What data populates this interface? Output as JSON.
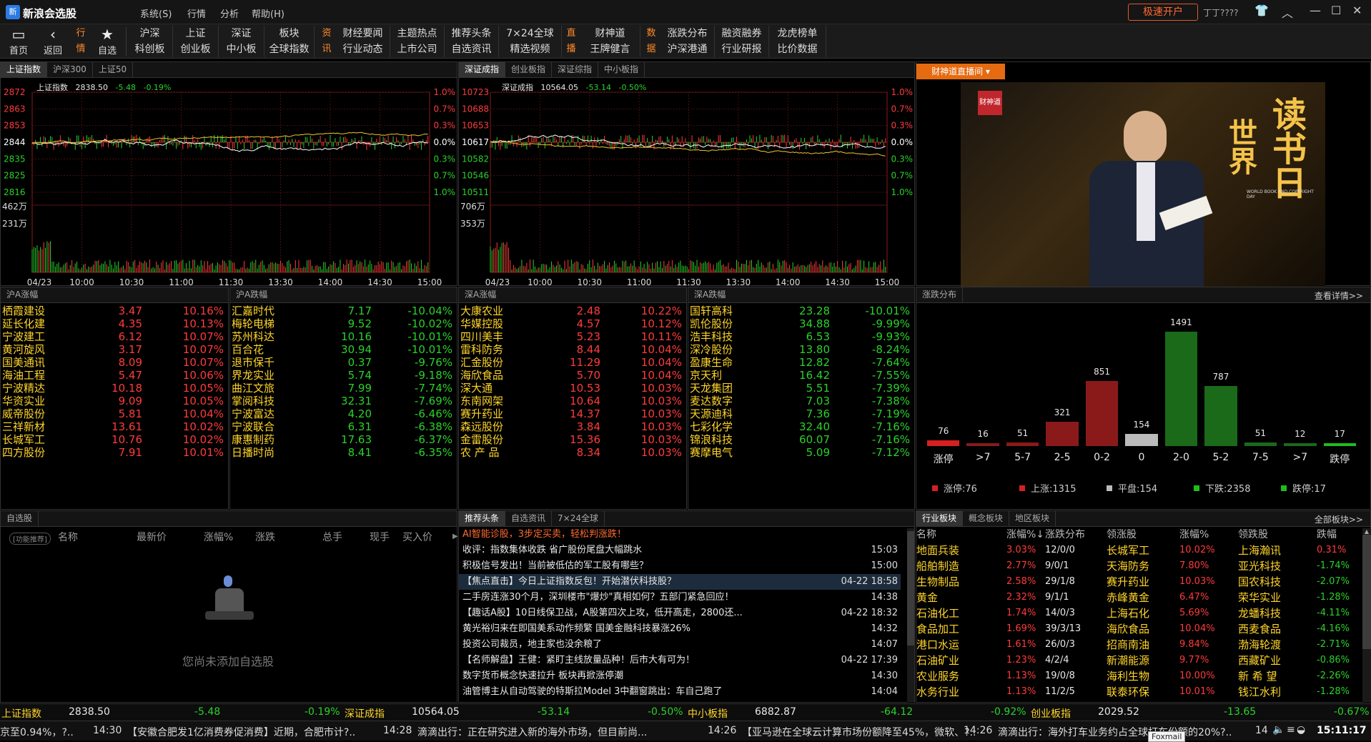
{
  "titlebar": {
    "logo": "新",
    "app_name": "新浪会选股",
    "menus": [
      "系统(S)",
      "行情",
      "分析",
      "帮助(H)"
    ],
    "kaihu": "极速开户",
    "user": "丁丁????",
    "window_buttons": [
      "shirt-icon",
      "chevron-up-icon",
      "minimize-icon",
      "maximize-icon",
      "close-icon"
    ]
  },
  "toolbar": {
    "home": "首页",
    "back": "返回",
    "fav": "自选",
    "tag_hq": "行情",
    "tag_zx": "资讯",
    "tag_zb": "直播",
    "tag_sj": "数据",
    "hq_row1": [
      "沪深",
      "上证",
      "深证",
      "板块"
    ],
    "hq_row2": [
      "科创板",
      "创业板",
      "中小板",
      "全球指数"
    ],
    "zx_row1": [
      "财经要闻",
      "主题热点",
      "推荐头条",
      "7×24全球"
    ],
    "zx_row2": [
      "行业动态",
      "上市公司",
      "自选资讯",
      "精选视频"
    ],
    "zb_row1": [
      "财神道"
    ],
    "zb_row2": [
      "王牌健言"
    ],
    "sj_row1": [
      "涨跌分布",
      "融资融券",
      "龙虎榜单"
    ],
    "sj_row2": [
      "沪深港通",
      "行业研报",
      "比价数据"
    ]
  },
  "sh_panel": {
    "tabs": [
      "上证指数",
      "沪深300",
      "上证50"
    ],
    "name": "上证指数",
    "last": "2838.50",
    "chg": "-5.48",
    "pct": "-0.19%",
    "y_left": [
      "2872",
      "2863",
      "2853",
      "2844",
      "2835",
      "2825",
      "2816"
    ],
    "y_right": [
      "1.0%",
      "0.7%",
      "0.3%",
      "0.0%",
      "0.3%",
      "0.7%",
      "1.0%"
    ],
    "vol_labels": [
      "462万",
      "231万"
    ],
    "x_labels": [
      "04/23",
      "10:00",
      "10:30",
      "11:00",
      "11:30",
      "13:30",
      "14:00",
      "14:30",
      "15:00"
    ]
  },
  "sz_panel": {
    "tabs": [
      "深证成指",
      "创业板指",
      "深证综指",
      "中小板指"
    ],
    "name": "深证成指",
    "last": "10564.05",
    "chg": "-53.14",
    "pct": "-0.50%",
    "y_left": [
      "10723",
      "10688",
      "10653",
      "10617",
      "10582",
      "10546",
      "10511"
    ],
    "y_right": [
      "1.0%",
      "0.7%",
      "0.3%",
      "0.0%",
      "0.3%",
      "0.7%",
      "1.0%"
    ],
    "vol_labels": [
      "706万",
      "353万"
    ],
    "x_labels": [
      "04/23",
      "10:00",
      "10:30",
      "11:00",
      "11:30",
      "13:30",
      "14:00",
      "14:30",
      "15:00"
    ]
  },
  "live": {
    "button": "财神道直播间 ▾",
    "logo": "财神道",
    "book_title": "读书日",
    "book_sub": "世界",
    "book_caption": "WORLD BOOK AND COPYRIGHT DAY"
  },
  "sh_up": {
    "title": "沪A涨幅",
    "rows": [
      [
        "栖霞建设",
        "3.47",
        "10.16%"
      ],
      [
        "延长化建",
        "4.35",
        "10.13%"
      ],
      [
        "宁波建工",
        "6.12",
        "10.07%"
      ],
      [
        "黄河旋风",
        "3.17",
        "10.07%"
      ],
      [
        "国美通讯",
        "8.09",
        "10.07%"
      ],
      [
        "海油工程",
        "5.47",
        "10.06%"
      ],
      [
        "宁波精达",
        "10.18",
        "10.05%"
      ],
      [
        "华资实业",
        "9.09",
        "10.05%"
      ],
      [
        "威帝股份",
        "5.81",
        "10.04%"
      ],
      [
        "三祥新材",
        "13.61",
        "10.02%"
      ],
      [
        "长城军工",
        "10.76",
        "10.02%"
      ],
      [
        "四方股份",
        "7.91",
        "10.01%"
      ]
    ]
  },
  "sh_dn": {
    "title": "沪A跌幅",
    "rows": [
      [
        "汇嘉时代",
        "7.17",
        "-10.04%"
      ],
      [
        "梅轮电梯",
        "9.52",
        "-10.02%"
      ],
      [
        "苏州科达",
        "10.16",
        "-10.01%"
      ],
      [
        "百合花",
        "30.94",
        "-10.01%"
      ],
      [
        "退市保千",
        "0.37",
        "-9.76%"
      ],
      [
        "界龙实业",
        "5.74",
        "-9.18%"
      ],
      [
        "曲江文旅",
        "7.99",
        "-7.74%"
      ],
      [
        "掌阅科技",
        "32.31",
        "-7.69%"
      ],
      [
        "宁波富达",
        "4.20",
        "-6.46%"
      ],
      [
        "宁波联合",
        "6.31",
        "-6.38%"
      ],
      [
        "康惠制药",
        "17.63",
        "-6.37%"
      ],
      [
        "日播时尚",
        "8.41",
        "-6.35%"
      ]
    ]
  },
  "sz_up": {
    "title": "深A涨幅",
    "rows": [
      [
        "大康农业",
        "2.48",
        "10.22%"
      ],
      [
        "华媒控股",
        "4.57",
        "10.12%"
      ],
      [
        "四川美丰",
        "5.23",
        "10.11%"
      ],
      [
        "雷科防务",
        "8.44",
        "10.04%"
      ],
      [
        "汇金股份",
        "11.29",
        "10.04%"
      ],
      [
        "海欣食品",
        "5.70",
        "10.04%"
      ],
      [
        "深大通",
        "10.53",
        "10.03%"
      ],
      [
        "东南网架",
        "10.64",
        "10.03%"
      ],
      [
        "赛升药业",
        "14.37",
        "10.03%"
      ],
      [
        "森远股份",
        "3.84",
        "10.03%"
      ],
      [
        "金雷股份",
        "15.36",
        "10.03%"
      ],
      [
        "农 产 品",
        "8.34",
        "10.03%"
      ]
    ]
  },
  "sz_dn": {
    "title": "深A跌幅",
    "rows": [
      [
        "国轩高科",
        "23.28",
        "-10.01%"
      ],
      [
        "凯伦股份",
        "34.88",
        "-9.99%"
      ],
      [
        "浩丰科技",
        "6.53",
        "-9.93%"
      ],
      [
        "深冷股份",
        "13.80",
        "-8.24%"
      ],
      [
        "盈康生命",
        "12.82",
        "-7.64%"
      ],
      [
        "京天利",
        "16.42",
        "-7.55%"
      ],
      [
        "天龙集团",
        "5.51",
        "-7.39%"
      ],
      [
        "麦达数字",
        "7.03",
        "-7.38%"
      ],
      [
        "天源迪科",
        "7.36",
        "-7.19%"
      ],
      [
        "七彩化学",
        "32.40",
        "-7.16%"
      ],
      [
        "锦浪科技",
        "60.07",
        "-7.16%"
      ],
      [
        "赛摩电气",
        "5.09",
        "-7.12%"
      ]
    ]
  },
  "dist": {
    "title": "涨跌分布",
    "more": "查看详情>>",
    "labels": [
      "涨停",
      ">7",
      "5-7",
      "2-5",
      "0-2",
      "0",
      "2-0",
      "5-2",
      "7-5",
      ">7",
      "跌停"
    ],
    "values": [
      76,
      16,
      51,
      321,
      851,
      154,
      1491,
      787,
      51,
      12,
      17
    ],
    "colors": [
      "#d62020",
      "#8a1a1a",
      "#8a1a1a",
      "#8a1a1a",
      "#8a1a1a",
      "#bbbbbb",
      "#1a6a1a",
      "#1a6a1a",
      "#1a6a1a",
      "#1a6a1a",
      "#1dbd1d"
    ],
    "legend": [
      "涨停:76",
      "上涨:1315",
      "平盘:154",
      "下跌:2358",
      "跌停:17"
    ]
  },
  "watch": {
    "title": "自选股",
    "tag": "[功能推荐]",
    "cols": [
      "名称",
      "最新价",
      "涨幅%",
      "涨跌",
      "总手",
      "现手",
      "买入价"
    ],
    "empty": "您尚未添加自选股"
  },
  "news": {
    "tabs": [
      "推荐头条",
      "自选资讯",
      "7×24全球"
    ],
    "items": [
      [
        "AI智能诊股，3步定买卖，轻松判涨跌！",
        ""
      ],
      [
        "收评：指数集体收跌 省广股份尾盘大幅跳水",
        "15:03"
      ],
      [
        "积极信号发出！当前被低估的军工股有哪些？",
        "15:00"
      ],
      [
        "【焦点直击】今日上证指数反包！开始潜伏科技股？",
        "04-22 18:58"
      ],
      [
        "二手房连涨30个月，深圳楼市\"爆炒\"真相如何？五部门紧急回应！",
        "14:38"
      ],
      [
        "【趣话A股】10日线保卫战，A股第四次上攻，低开高走，2800还...",
        "04-22 18:32"
      ],
      [
        "黄光裕归来在即国美系动作频繁 国美金融科技暴涨26%",
        "14:32"
      ],
      [
        "投资公司裁员，地主家也没余粮了",
        "14:07"
      ],
      [
        "【名师解盘】王健：紧盯主线放量品种！后市大有可为！",
        "04-22 17:39"
      ],
      [
        "数字货币概念快速拉升 板块再掀涨停潮",
        "14:30"
      ],
      [
        "油管博主从自动驾驶的特斯拉Model 3中翻窗跳出：车自己跑了",
        "14:04"
      ]
    ]
  },
  "sector": {
    "tabs": [
      "行业板块",
      "概念板块",
      "地区板块"
    ],
    "more": "全部板块>>",
    "cols": [
      "名称",
      "涨幅%↓",
      "涨跌分布",
      "领涨股",
      "涨幅%",
      "领跌股",
      "跌幅"
    ],
    "rows": [
      [
        "地面兵装",
        "3.03%",
        "12/0/0",
        "长城军工",
        "10.02%",
        "上海瀚讯",
        "0.31%"
      ],
      [
        "船舶制造",
        "2.77%",
        "9/0/1",
        "天海防务",
        "7.80%",
        "亚光科技",
        "-1.74%"
      ],
      [
        "生物制品",
        "2.58%",
        "29/1/8",
        "赛升药业",
        "10.03%",
        "国农科技",
        "-2.07%"
      ],
      [
        "黄金",
        "2.32%",
        "9/1/1",
        "赤峰黄金",
        "6.47%",
        "荣华实业",
        "-1.28%"
      ],
      [
        "石油化工",
        "1.74%",
        "14/0/3",
        "上海石化",
        "5.69%",
        "龙蟠科技",
        "-4.11%"
      ],
      [
        "食品加工",
        "1.69%",
        "39/3/13",
        "海欣食品",
        "10.04%",
        "西麦食品",
        "-4.16%"
      ],
      [
        "港口水运",
        "1.61%",
        "26/0/3",
        "招商南油",
        "9.84%",
        "渤海轮渡",
        "-2.71%"
      ],
      [
        "石油矿业",
        "1.23%",
        "4/2/4",
        "新潮能源",
        "9.77%",
        "西藏矿业",
        "-0.86%"
      ],
      [
        "农业服务",
        "1.13%",
        "19/0/8",
        "海利生物",
        "10.00%",
        "新 希 望",
        "-2.26%"
      ],
      [
        "水务行业",
        "1.13%",
        "11/2/5",
        "联泰环保",
        "10.01%",
        "钱江水利",
        "-1.28%"
      ]
    ]
  },
  "statusbar": [
    [
      "上证指数",
      "2838.50",
      "-5.48",
      "-0.19%"
    ],
    [
      "深证成指",
      "10564.05",
      "-53.14",
      "-0.50%"
    ],
    [
      "中小板指",
      "6882.87",
      "-64.12",
      "-0.92%"
    ],
    [
      "创业板指",
      "2029.52",
      "-13.65",
      "-0.67%"
    ]
  ],
  "ticker": {
    "items": [
      "京至0.94%，?..",
      "14:30",
      "【安徽合肥发1亿消费券促消费】近期，合肥市计?..",
      "14:28",
      "滴滴出行：正在研究进入新的海外市场，但目前尚...",
      "14:26",
      "【亚马逊在全球云计算市场份额降至45%，微软、?..",
      "14:26",
      "滴滴出行：海外打车业务约占全球打车份额的20%?.."
    ],
    "count": "14",
    "clock": "15:11:17",
    "tooltip": "Foxmail"
  }
}
